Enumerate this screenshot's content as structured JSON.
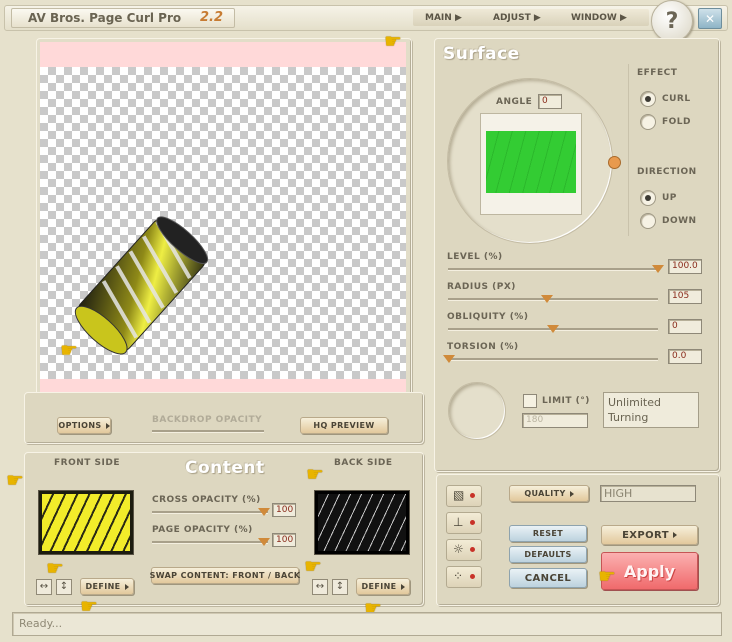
{
  "window": {
    "title": "AV Bros. Page Curl Pro",
    "version": "2.2",
    "menu": [
      "MAIN",
      "ADJUST",
      "WINDOW"
    ],
    "help_label": "?",
    "close_label": "✕"
  },
  "preview": {
    "options_label": "OPTIONS",
    "backdrop_opacity_label": "BACKDROP OPACITY",
    "hq_preview_label": "HQ PREVIEW"
  },
  "surface": {
    "title": "Surface",
    "angle_label": "ANGLE",
    "angle_value": "0",
    "effect_label": "EFFECT",
    "effect_options": [
      "CURL",
      "FOLD"
    ],
    "effect_selected": "CURL",
    "direction_label": "DIRECTION",
    "direction_options": [
      "UP",
      "DOWN"
    ],
    "direction_selected": "UP",
    "sliders": [
      {
        "label": "LEVEL (%)",
        "value": "100.0",
        "fraction": 1.0
      },
      {
        "label": "RADIUS (PX)",
        "value": "105",
        "fraction": 0.46
      },
      {
        "label": "OBLIQUITY (%)",
        "value": "0",
        "fraction": 0.5
      },
      {
        "label": "TORSION (%)",
        "value": "0.0",
        "fraction": 0.0
      }
    ],
    "limit_label": "LIMIT (°)",
    "limit_value": "180",
    "limit_status": "Unlimited Turning"
  },
  "content": {
    "title": "Content",
    "front_side_label": "FRONT SIDE",
    "back_side_label": "BACK SIDE",
    "cross_opacity_label": "CROSS OPACITY (%)",
    "cross_opacity_value": "100",
    "page_opacity_label": "PAGE OPACITY (%)",
    "page_opacity_value": "100",
    "swap_label": "SWAP CONTENT: FRONT / BACK",
    "define_label": "DEFINE",
    "flip_h_icon": "↔",
    "flip_v_icon": "↕"
  },
  "output": {
    "quality_label": "QUALITY",
    "quality_value": "HIGH",
    "reset_label": "RESET",
    "defaults_label": "DEFAULTS",
    "cancel_label": "CANCEL",
    "export_label": "EXPORT",
    "apply_label": "Apply"
  },
  "status": {
    "text": "Ready..."
  },
  "colors": {
    "accent": "#d08a3a",
    "front_fill": "#f2ec2a",
    "back_fill": "#111111",
    "surface_green": "#33cc33",
    "apply": "#f47a7c"
  }
}
